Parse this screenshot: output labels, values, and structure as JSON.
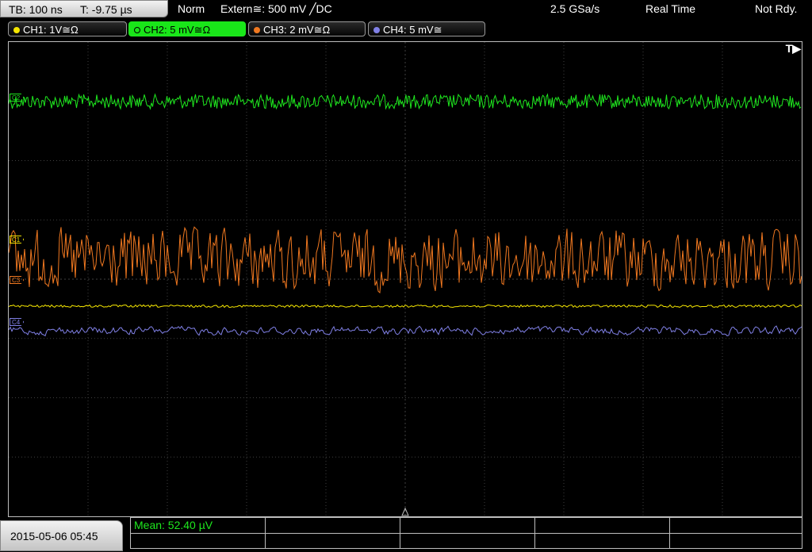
{
  "header": {
    "timebase": "TB: 100 ns",
    "trigger_time": "T: -9.75 µs",
    "mode": "Norm",
    "trigger_source": "Extern≅: 500 mV ╱DC",
    "sample_rate": "2.5 GSa/s",
    "acq_mode": "Real Time",
    "status": "Not Rdy."
  },
  "channels": [
    {
      "label": "CH1: 1V≅Ω",
      "color": "#f5e600",
      "active": false
    },
    {
      "label": "CH2: 5 mV≅Ω",
      "color": "#1ee81e",
      "active": true
    },
    {
      "label": "CH3: 2 mV≅Ω",
      "color": "#f07820",
      "active": false
    },
    {
      "label": "CH4: 5 mV≅",
      "color": "#8080e6",
      "active": false
    }
  ],
  "trace_labels": {
    "c1": "C1",
    "c2": "C2",
    "c3": "C3",
    "c4": "C4"
  },
  "trigger_marker": "T▶",
  "footer": {
    "datetime": "2015-05-06 05:45",
    "measurement": "Mean: 52.40 µV"
  },
  "colors": {
    "grid": "#404040",
    "border": "#bdbdbd",
    "ch1": "#f5e600",
    "ch2": "#1ee81e",
    "ch3": "#f07820",
    "ch4": "#8080e6"
  }
}
